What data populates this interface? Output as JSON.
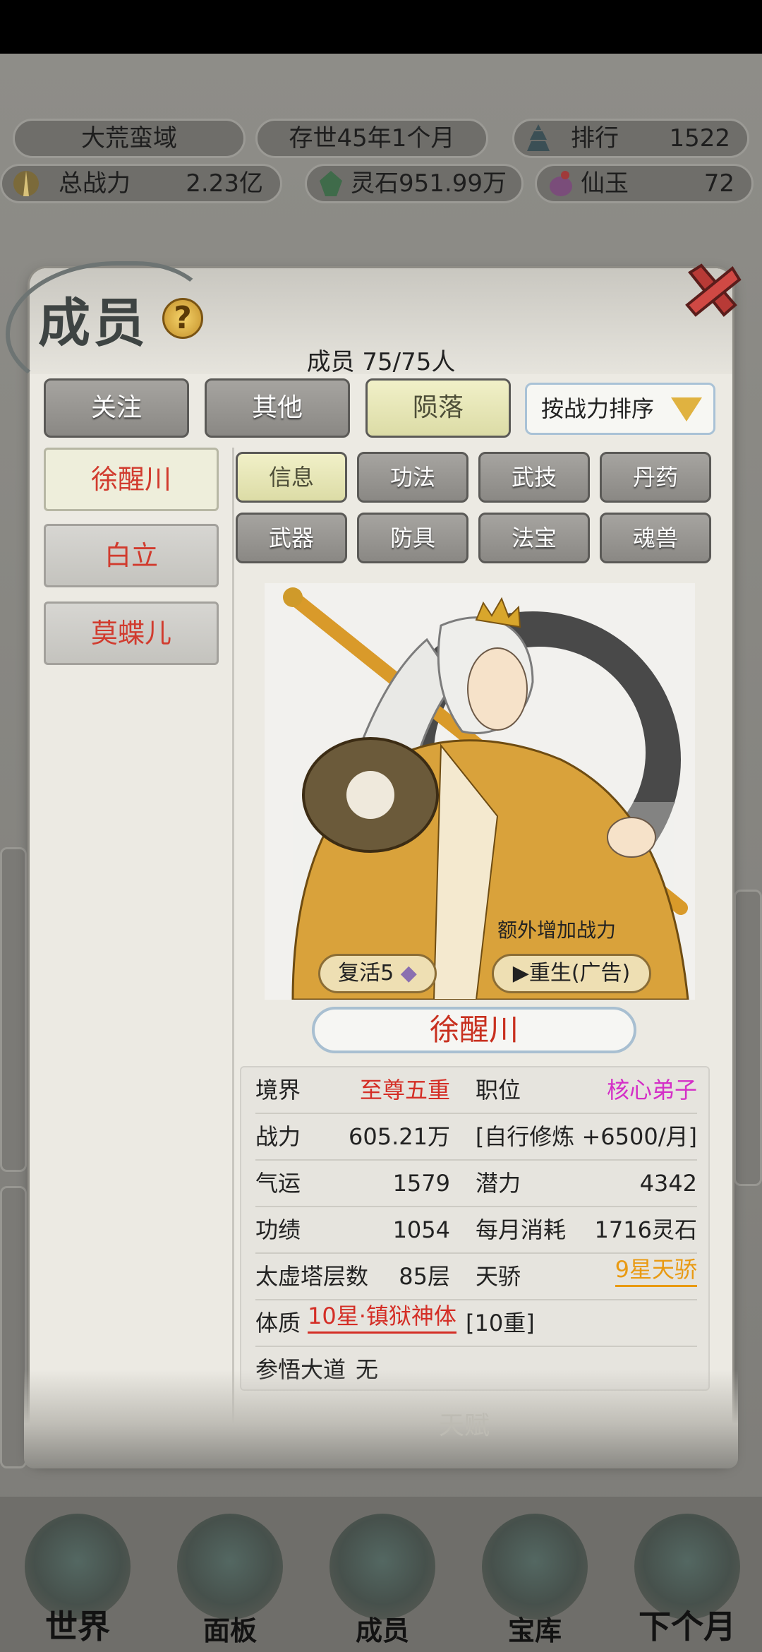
{
  "background": {
    "realm": "大荒蛮域",
    "time": "存世45年1个月",
    "rank_label": "排行",
    "rank_value": "1522",
    "power_label": "总战力",
    "power_value": "2.23亿",
    "stone": "灵石951.99万",
    "jade_label": "仙玉",
    "jade_value": "72",
    "bottom_tabs": [
      "世界",
      "面板",
      "成员",
      "宝库",
      "下个月"
    ]
  },
  "modal": {
    "title": "成员",
    "help": "?",
    "member_count": "成员  75/75人",
    "filters": [
      "关注",
      "其他",
      "陨落"
    ],
    "sort": "按战力排序",
    "members": [
      "徐醒川",
      "白立",
      "莫蝶儿"
    ],
    "tabs": [
      "信息",
      "功法",
      "武技",
      "丹药",
      "武器",
      "防具",
      "法宝",
      "魂兽"
    ],
    "portrait": {
      "extra_power": "额外增加战力",
      "revive": "复活5",
      "reborn": "▶重生(广告)"
    },
    "name": "徐醒川",
    "stats": {
      "realm_label": "境界",
      "realm_value": "至尊五重",
      "position_label": "职位",
      "position_value": "核心弟子",
      "power_label": "战力",
      "power_value": "605.21万",
      "training": "[自行修炼 +6500/月]",
      "luck_label": "气运",
      "luck_value": "1579",
      "potential_label": "潜力",
      "potential_value": "4342",
      "merit_label": "功绩",
      "merit_value": "1054",
      "monthly_label": "每月消耗",
      "monthly_value": "1716灵石",
      "tower_label": "太虚塔层数",
      "tower_value": "85层",
      "genius_label": "天骄",
      "genius_value": "9星天骄",
      "physique_label": "体质",
      "physique_value": "10星·镇狱神体",
      "physique_level": "[10重]",
      "dao_label": "参悟大道",
      "dao_value": "无"
    },
    "footer_hint": "天赋"
  },
  "colors": {
    "red": "#d42e26",
    "magenta": "#d42fc7",
    "orange": "#e99a12",
    "selected_button": "#eeeedb"
  }
}
